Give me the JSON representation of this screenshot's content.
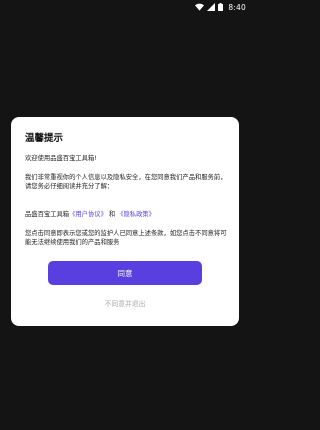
{
  "status_bar": {
    "time": "8:40",
    "icons": [
      "wifi-icon",
      "signal-icon",
      "battery-icon"
    ]
  },
  "dialog": {
    "title": "温馨提示",
    "welcome": "欢迎使用品盛百宝工具箱!",
    "privacy_intro": "我们非常重视你的个人信息以及隐私安全，在您同意我们产品和服务前，请您务必仔细阅读并充分了解：",
    "app_name": "品盛百宝工具箱",
    "user_agreement_link": "《用户协议》",
    "and_text": "和",
    "privacy_policy_link": "《隐私政策》",
    "consent_text": "您点击同意即表示您或您的监护人已同意上述条款，如您点击不同意将可能无法继续使用我们的产品和服务",
    "agree_button": "同意",
    "decline_link": "不同意并退出"
  },
  "colors": {
    "accent": "#5a3fe0",
    "background": "#141414",
    "dialog": "#ffffff"
  }
}
